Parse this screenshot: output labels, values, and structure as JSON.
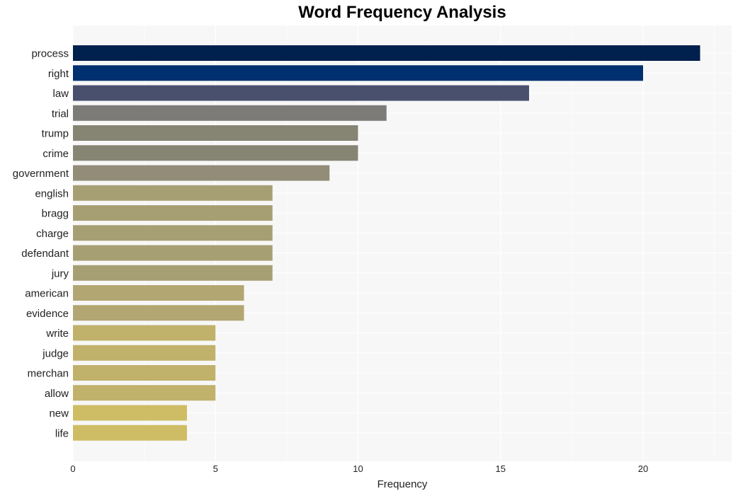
{
  "chart_data": {
    "type": "bar",
    "orientation": "horizontal",
    "title": "Word Frequency Analysis",
    "xlabel": "Frequency",
    "ylabel": "",
    "xlim": [
      0,
      23.1
    ],
    "xticks": [
      0,
      5,
      10,
      15,
      20
    ],
    "grid": true,
    "legend": "none",
    "categories": [
      "process",
      "right",
      "law",
      "trial",
      "trump",
      "crime",
      "government",
      "english",
      "bragg",
      "charge",
      "defendant",
      "jury",
      "american",
      "evidence",
      "write",
      "judge",
      "merchan",
      "allow",
      "new",
      "life"
    ],
    "values": [
      22,
      20,
      16,
      11,
      10,
      10,
      9,
      7,
      7,
      7,
      7,
      7,
      6,
      6,
      5,
      5,
      5,
      5,
      4,
      4
    ],
    "colors": [
      "#00204e",
      "#00306f",
      "#48506d",
      "#7c7b78",
      "#868574",
      "#868574",
      "#928c78",
      "#a79f74",
      "#a79f74",
      "#a79f74",
      "#a79f74",
      "#a79f74",
      "#b2a672",
      "#b2a672",
      "#c0b16b",
      "#c0b16b",
      "#c0b16b",
      "#c0b16b",
      "#cebd64",
      "#cebd64"
    ]
  }
}
